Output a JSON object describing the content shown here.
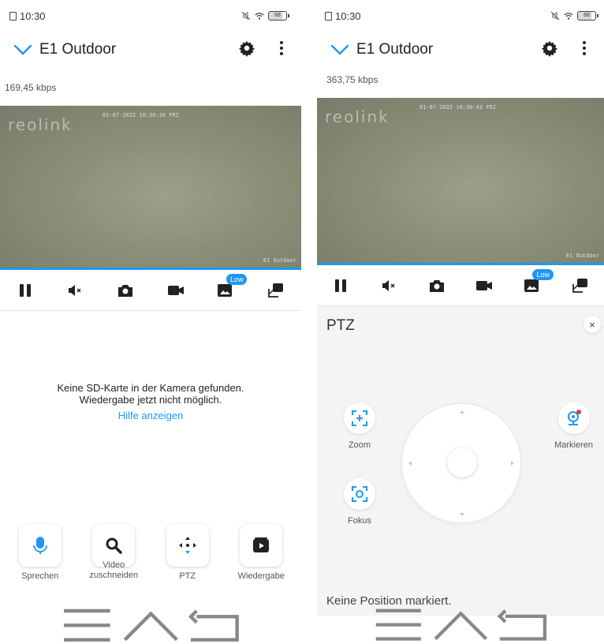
{
  "status_bar": {
    "time": "10:30",
    "battery": "68"
  },
  "header": {
    "title": "E1 Outdoor"
  },
  "left": {
    "bitrate": "169,45 kbps"
  },
  "right": {
    "bitrate": "363,75 kbps"
  },
  "video": {
    "logo": "reolink",
    "osd_time": "01-07-2022 10:30:30 FRI",
    "osd_time_right": "01-07-2022 10:30:43 FRI",
    "osd_name": "E1 Outdoor"
  },
  "controls": {
    "low_badge": "Low"
  },
  "playback": {
    "message_line1": "Keine SD-Karte in der Kamera gefunden.",
    "message_line2": "Wiedergabe jetzt nicht möglich.",
    "help_link": "Hilfe anzeigen"
  },
  "tools": [
    {
      "label": "Sprechen",
      "icon": "microphone-icon"
    },
    {
      "label": "Video\nzuschneiden",
      "icon": "magnifier-icon"
    },
    {
      "label": "PTZ",
      "icon": "ptz-move-icon"
    },
    {
      "label": "Wiedergabe",
      "icon": "play-icon"
    }
  ],
  "ptz": {
    "title": "PTZ",
    "close": "×",
    "zoom": "Zoom",
    "focus": "Fokus",
    "mark": "Markieren",
    "status": "Keine Position markiert."
  },
  "colors": {
    "accent": "#2196f3",
    "text": "#222222",
    "panel": "#f4f4f4"
  }
}
